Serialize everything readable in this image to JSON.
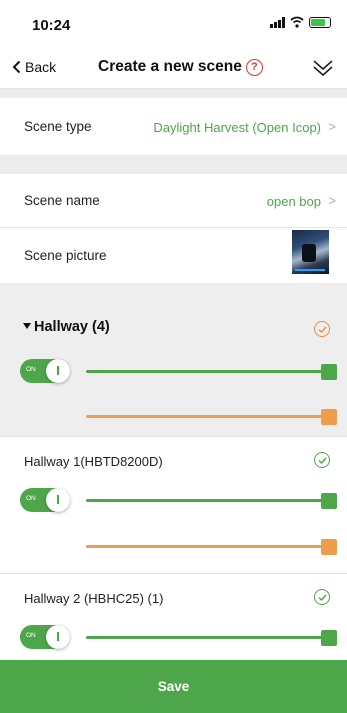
{
  "status_bar": {
    "time": "10:24"
  },
  "nav": {
    "back_label": "Back",
    "title": "Create a new scene",
    "help_glyph": "?"
  },
  "scene_type": {
    "label": "Scene type",
    "value": "Daylight Harvest (Open Icop)"
  },
  "scene_name": {
    "label": "Scene name",
    "value": "open bop"
  },
  "scene_picture": {
    "label": "Scene picture"
  },
  "group": {
    "title": "Hallway (4)",
    "toggle_text": "ON"
  },
  "devices": [
    {
      "name": "Hallway 1(HBTD8200D)",
      "toggle_text": "ON"
    },
    {
      "name": "Hallway 2 (HBHC25) (1)",
      "toggle_text": "ON"
    }
  ],
  "save_label": "Save",
  "colors": {
    "accent_green": "#4ea64a",
    "accent_orange": "#ef9c4c",
    "help_red": "#e0352b"
  },
  "icons": [
    "signal-icon",
    "wifi-icon",
    "battery-charging-icon",
    "chevron-left-icon",
    "help-icon",
    "double-chevron-down-icon",
    "chevron-right-icon",
    "check-circle-icon",
    "caret-down-icon"
  ]
}
